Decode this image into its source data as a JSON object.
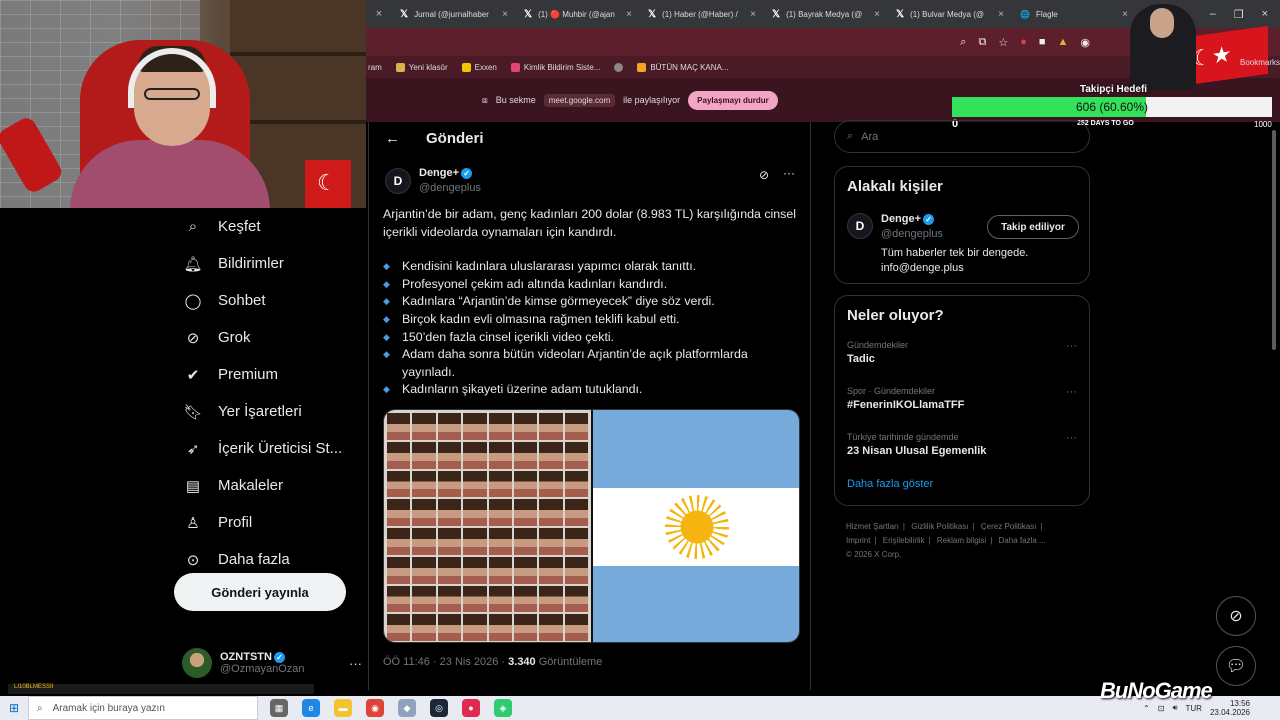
{
  "browser": {
    "tabs": [
      {
        "label": "Jurnal (@jurnalhaber",
        "icon": "x-logo"
      },
      {
        "label": "(1) 🔴 Muhbir (@ajan",
        "icon": "x-logo"
      },
      {
        "label": "(1) Haber (@Haber) /",
        "icon": "x-logo"
      },
      {
        "label": "(1) Bayrak Medya (@",
        "icon": "x-logo"
      },
      {
        "label": "(1) Bulvar Medya (@",
        "icon": "x-logo"
      },
      {
        "label": "Flagle",
        "icon": "globe-icon"
      }
    ],
    "bookmarks": [
      {
        "label": "ram",
        "color": "#4a1a26"
      },
      {
        "label": "Yeni klasör",
        "color": "#d8b24a"
      },
      {
        "label": "Exxen",
        "color": "#f2c500"
      },
      {
        "label": "Kimlik Bildirim Siste...",
        "color": "#e0457b"
      },
      {
        "label": "",
        "color": "#888888"
      },
      {
        "label": "BÜTÜN MAÇ KANA...",
        "color": "#f5a623"
      }
    ],
    "share": {
      "prefix": "Bu sekme",
      "url": "meet.google.com",
      "suffix": "ile paylaşılıyor",
      "stop_label": "Paylaşmayı durdur"
    }
  },
  "overlay": {
    "right_label": "Bookmarks",
    "goal_title": "Takipçi Hedefi",
    "goal_text": "606 (60.60%)",
    "goal_fraction": 0.606,
    "goal_min": "0",
    "goal_days": "252 DAYS TO GO",
    "goal_max": "1000",
    "ticker": "LI10BLMESSII"
  },
  "nav": {
    "items": [
      {
        "label": "Keşfet",
        "icon": "search-icon",
        "glyph": "⌕"
      },
      {
        "label": "Bildirimler",
        "icon": "bell-icon",
        "glyph": "🔔"
      },
      {
        "label": "Sohbet",
        "icon": "chat-icon",
        "glyph": "○"
      },
      {
        "label": "Grok",
        "icon": "grok-icon",
        "glyph": "⊘"
      },
      {
        "label": "Premium",
        "icon": "premium-icon",
        "glyph": "✓"
      },
      {
        "label": "Yer İşaretleri",
        "icon": "bookmark-icon",
        "glyph": "⊓"
      },
      {
        "label": "İçerik Üreticisi St...",
        "icon": "rocket-icon",
        "glyph": "➶"
      },
      {
        "label": "Makaleler",
        "icon": "article-icon",
        "glyph": "▤"
      },
      {
        "label": "Profil",
        "icon": "profile-icon",
        "glyph": "♙"
      },
      {
        "label": "Daha fazla",
        "icon": "more-circle-icon",
        "glyph": "⋯"
      }
    ],
    "post_button": "Gönderi yayınla",
    "account": {
      "name": "OZNTSTN",
      "handle": "@OzmayanOzan"
    }
  },
  "post": {
    "header": "Gönderi",
    "author": {
      "name": "Denge+",
      "handle": "@dengeplus",
      "avatar_letter": "D"
    },
    "intro": "Arjantin’de bir adam, genç kadınları 200 dolar (8.983 TL) karşılığında cinsel içerikli videolarda oynamaları için kandırdı.",
    "bullets": [
      "Kendisini kadınlara uluslararası yapımcı olarak tanıttı.",
      "Profesyonel çekim adı altında kadınları kandırdı.",
      "Kadınlara “Arjantin’de kimse görmeyecek” diye söz verdi.",
      "Birçok kadın evli olmasına rağmen teklifi kabul etti.",
      "150’den fazla cinsel içerikli video çekti.",
      "Adam daha sonra bütün videoları Arjantin’de açık platformlarda yayınladı.",
      "Kadınların şikayeti üzerine adam tutuklandı."
    ],
    "meta_time": "ÖÖ 11:46 · 23 Nis 2026 · ",
    "meta_views": "3.340",
    "meta_views_label": " Görüntüleme"
  },
  "sidebar": {
    "search_placeholder": "Ara",
    "related_title": "Alakalı kişiler",
    "related": {
      "name": "Denge+",
      "handle": "@dengeplus",
      "bio": "Tüm haberler tek bir dengede. info@denge.plus",
      "follow_label": "Takip ediliyor"
    },
    "trends_title": "Neler oluyor?",
    "trends": [
      {
        "category": "Gündemdekiler",
        "name": "Tadic"
      },
      {
        "category": "Spor · Gündemdekiler",
        "name": "#FenerinIKOLlamaTFF"
      },
      {
        "category": "Türkiye tarihinde gündemde",
        "name": "23 Nisan Ulusal Egemenlik"
      }
    ],
    "show_more": "Daha fazla göster",
    "footer_links": [
      "Hizmet Şartları",
      "|",
      "Gizlilik Politikası",
      "|",
      "Çerez Politikası",
      "|",
      "Imprint",
      "|",
      "Erişilebilirlik",
      "|",
      "Reklam bilgisi",
      "|",
      "Daha fazla ..."
    ],
    "copyright": "© 2026 X Corp."
  },
  "taskbar": {
    "search_placeholder": "Aramak için buraya yazın",
    "lang": "TUR",
    "time": "13:56",
    "date": "23.04.2026",
    "brand": "BuNoGame"
  }
}
